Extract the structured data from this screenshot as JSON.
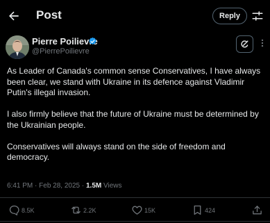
{
  "header": {
    "title": "Post",
    "reply_label": "Reply"
  },
  "author": {
    "name": "Pierre Poilievre",
    "handle": "@PierrePoilievre"
  },
  "tweet": {
    "paragraphs": [
      "As Leader of Canada's common sense Conservatives, I have always been clear, we stand with Ukraine in its defence against Vladimir Putin's illegal invasion.",
      "I also firmly believe that the future of Ukraine must be determined by the Ukrainian people.",
      "Conservatives will always stand on the side of freedom and democracy."
    ]
  },
  "meta": {
    "time": "6:41 PM",
    "separator": "·",
    "date": "Feb 28, 2025",
    "views_count": "1.5M",
    "views_label": "Views"
  },
  "actions": {
    "replies": "8.5K",
    "reposts": "2.2K",
    "likes": "15K",
    "bookmarks": "424"
  },
  "icons": {
    "back": "arrow-left-icon",
    "settings": "sliders-icon",
    "verified": "verified-badge-icon",
    "grok": "grok-icon",
    "more": "more-icon",
    "reply": "comment-icon",
    "repost": "repost-icon",
    "like": "heart-icon",
    "bookmark": "bookmark-icon",
    "share": "share-icon"
  },
  "colors": {
    "background": "#000000",
    "text": "#e7e9ea",
    "muted": "#71767b",
    "border": "#2f3336",
    "verified": "#1d9bf0"
  }
}
